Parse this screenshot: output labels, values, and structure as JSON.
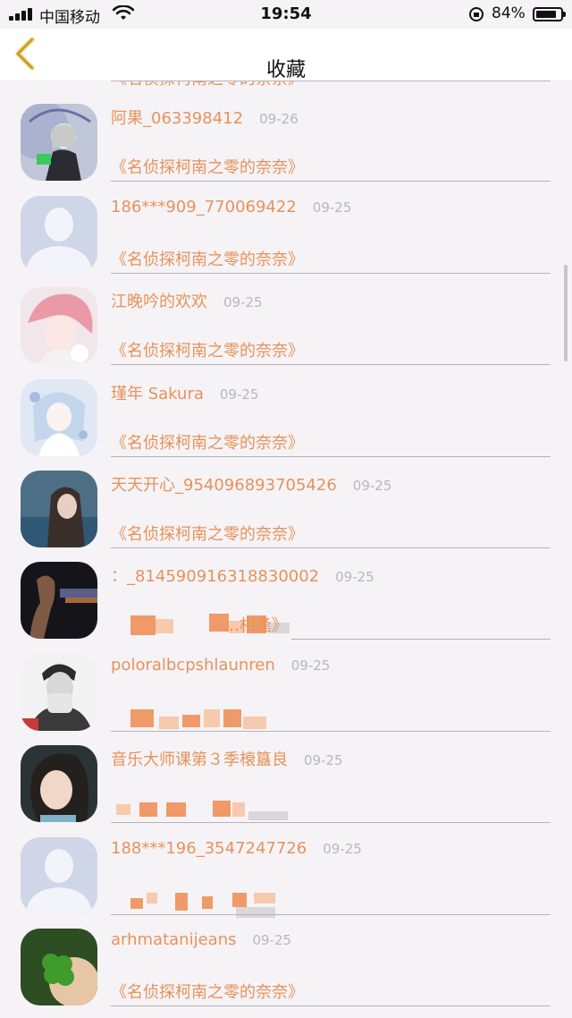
{
  "status_bar": {
    "carrier": "中国移动",
    "time": "19:54",
    "battery": "84%"
  },
  "nav": {
    "title": "收藏",
    "back_icon": "chevron-left-icon"
  },
  "list": {
    "partial_top_subtitle": "《名侦探柯南之零的奈奈》",
    "items": [
      {
        "name": "阿果_063398412",
        "date": "09-26",
        "subtitle": "《名侦探柯南之零的奈奈》"
      },
      {
        "name": "186***909_770069422",
        "date": "09-25",
        "subtitle": "《名侦探柯南之零的奈奈》"
      },
      {
        "name": "江晚吟的欢欢",
        "date": "09-25",
        "subtitle": "《名侦探柯南之零的奈奈》"
      },
      {
        "name": "瑾年 Sakura",
        "date": "09-25",
        "subtitle": "《名侦探柯南之零的奈奈》"
      },
      {
        "name": "天天开心_954096893705426",
        "date": "09-25",
        "subtitle": "《名侦探柯南之零的奈奈》"
      },
      {
        "name": "：_814590916318830002",
        "date": "09-25",
        "subtitle": "…相逢》"
      },
      {
        "name": "poloralbcpshlaunren",
        "date": "09-25",
        "subtitle": ""
      },
      {
        "name": "音乐大师课第３季榱簋良",
        "date": "09-25",
        "subtitle": ""
      },
      {
        "name": "188***196_3547247726",
        "date": "09-25",
        "subtitle": ""
      },
      {
        "name": "arhmatanijeans",
        "date": "09-25",
        "subtitle": "《名侦探柯南之零的奈奈》"
      }
    ]
  },
  "colors": {
    "accent": "#e8925a",
    "date": "#b9b6bd",
    "background": "#f5f3f6",
    "back_chevron": "#f0c850"
  }
}
